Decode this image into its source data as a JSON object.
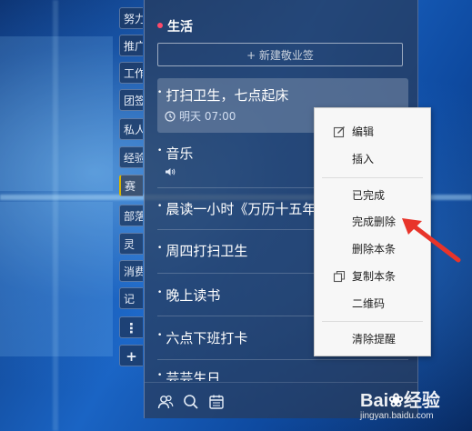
{
  "sidebar": {
    "tabs": [
      "努力",
      "推广",
      "工作",
      "团签",
      "私人",
      "经验",
      "赛",
      "部落",
      "灵",
      "消费",
      "记"
    ],
    "more_label": "⋮",
    "add_label": "+"
  },
  "group": {
    "title": "生活",
    "new_label": "+ 新建敬业签"
  },
  "notes": [
    {
      "title": "打扫卫生，七点起床",
      "reminder": "明天 07:00"
    },
    {
      "title": "音乐"
    },
    {
      "title": "晨读一小时《万历十五年"
    },
    {
      "title": "周四打扫卫生"
    },
    {
      "title": "晚上读书"
    },
    {
      "title": "六点下班打卡"
    },
    {
      "title": "芸芸生日"
    }
  ],
  "context_menu": {
    "items": [
      "编辑",
      "插入",
      "已完成",
      "完成删除",
      "删除本条",
      "复制本条",
      "二维码",
      "清除提醒"
    ]
  },
  "watermark": {
    "brand": "Bai",
    "brand2": "经验",
    "url": "jingyan.baidu.com"
  },
  "colors": {
    "accent_dot": "#ff4a6a",
    "arrow": "#e8342a",
    "active_tab": "#d8b400"
  }
}
